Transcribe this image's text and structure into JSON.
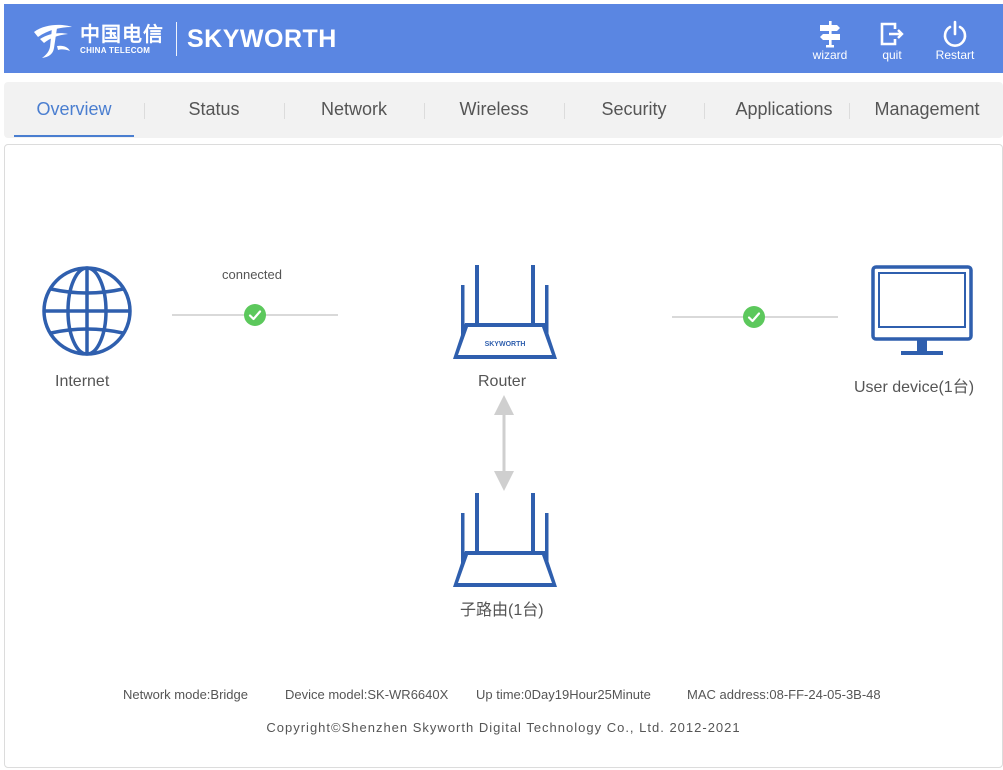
{
  "header": {
    "logo_cn": "中国电信",
    "logo_en": "CHINA TELECOM",
    "brand": "SKYWORTH",
    "buttons": {
      "wizard": "wizard",
      "quit": "quit",
      "restart": "Restart"
    }
  },
  "nav": {
    "tabs": [
      "Overview",
      "Status",
      "Network",
      "Wireless",
      "Security",
      "Applications",
      "Management"
    ],
    "active": "Overview"
  },
  "topology": {
    "internet_label": "Internet",
    "internet_status": "connected",
    "router_label": "Router",
    "router_brand": "SKYWORTH",
    "user_device_label": "User device(1台)",
    "sub_router_label": "子路由(1台)"
  },
  "footer": {
    "network_mode": "Network mode:Bridge",
    "device_model": "Device model:SK-WR6640X",
    "up_time": "Up time:0Day19Hour25Minute",
    "mac_address": "MAC address:08-FF-24-05-3B-48",
    "copyright": "Copyright©Shenzhen Skyworth Digital Technology Co., Ltd. 2012-2021"
  },
  "colors": {
    "header_bg": "#5a86e2",
    "accent": "#4a7ed0",
    "icon_blue": "#2f5fae",
    "ok_green": "#5cc85c"
  }
}
